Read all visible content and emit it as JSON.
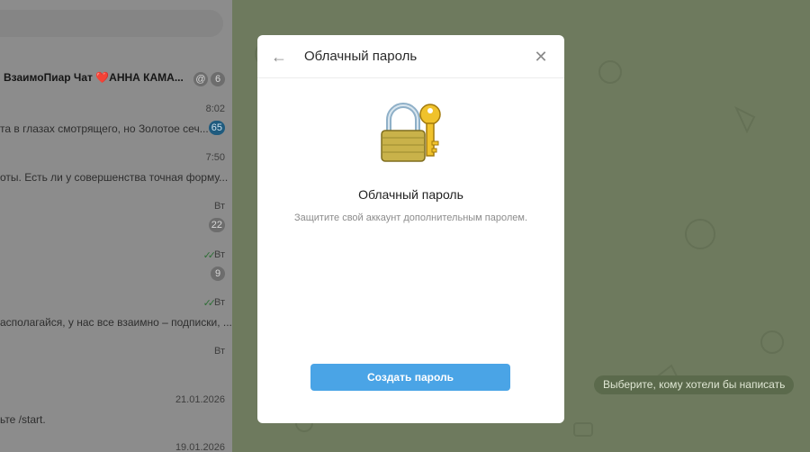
{
  "sidebar": {
    "chats": [
      {
        "name": "ВзаимоПиар Чат ❤️АННА КАМА...",
        "at_badge": "@",
        "badge": "6"
      },
      {
        "time": "8:02",
        "preview": "та в глазах смотрящего, но Золотое сеч...",
        "badge": "65"
      },
      {
        "time": "7:50",
        "preview": "оты.  Есть ли у совершенства точная форму..."
      },
      {
        "time": "Вт",
        "badge": "22"
      },
      {
        "time": "Вт",
        "badge": "9",
        "checks": "✓✓"
      },
      {
        "time": "Вт",
        "preview": "асполагайся, у нас все взаимно – подписки, ...",
        "checks": "✓✓"
      },
      {
        "time": "Вт"
      },
      {
        "time": "21.01.2026",
        "preview": "ьте /start."
      },
      {
        "time": "19.01.2026"
      }
    ]
  },
  "modal": {
    "title": "Облачный пароль",
    "heading": "Облачный пароль",
    "subtitle": "Защитите свой аккаунт дополнительным паролем.",
    "create_button": "Создать пароль",
    "back_icon": "←",
    "close_icon": "✕"
  },
  "chat": {
    "hint": "Выберите, кому хотели бы написать"
  },
  "colors": {
    "accent": "#4aa4e6",
    "chat_bg": "#6e7a5e"
  }
}
